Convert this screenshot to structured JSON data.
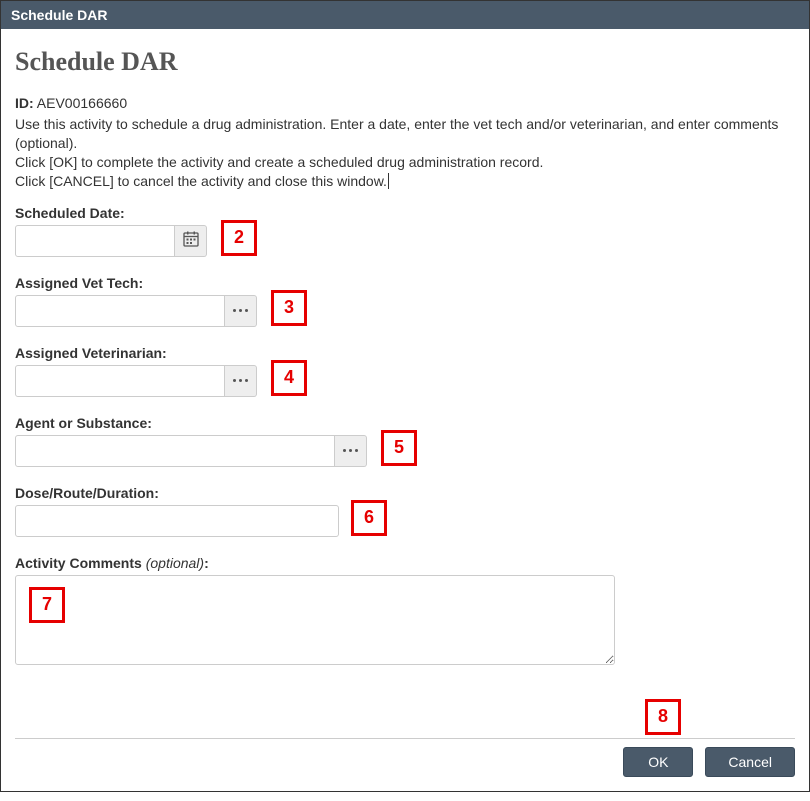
{
  "window": {
    "title": "Schedule DAR"
  },
  "page": {
    "heading": "Schedule DAR",
    "id_label": "ID:",
    "id_value": "AEV00166660",
    "instructions_line1": "Use this activity to schedule a drug administration. Enter a date, enter the vet tech and/or veterinarian, and enter comments (optional).",
    "instructions_line2": "Click [OK] to complete the activity and create a scheduled drug administration record.",
    "instructions_line3": "Click [CANCEL] to cancel the activity and close this window."
  },
  "fields": {
    "scheduled_date": {
      "label": "Scheduled Date:",
      "value": ""
    },
    "vet_tech": {
      "label": "Assigned Vet Tech:",
      "value": ""
    },
    "veterinarian": {
      "label": "Assigned Veterinarian:",
      "value": ""
    },
    "agent": {
      "label": "Agent or Substance:",
      "value": ""
    },
    "dose": {
      "label": "Dose/Route/Duration:",
      "value": ""
    },
    "comments": {
      "label_main": "Activity Comments ",
      "label_optional": "(optional)",
      "label_colon": ":",
      "value": ""
    }
  },
  "callouts": {
    "c2": "2",
    "c3": "3",
    "c4": "4",
    "c5": "5",
    "c6": "6",
    "c7": "7",
    "c8": "8"
  },
  "footer": {
    "ok": "OK",
    "cancel": "Cancel"
  }
}
